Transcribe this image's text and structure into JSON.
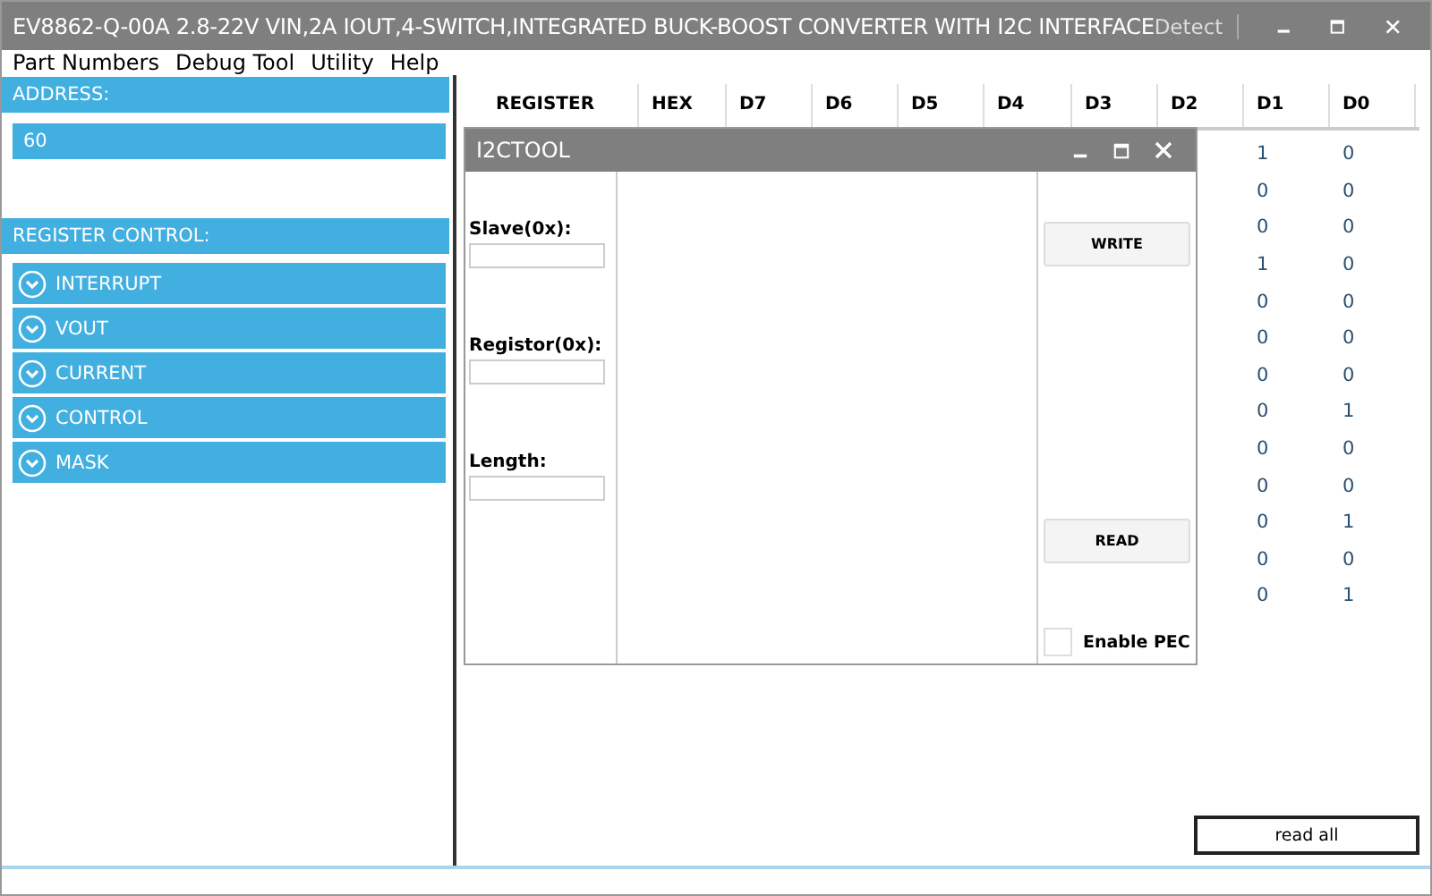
{
  "window": {
    "title": "EV8862-Q-00A 2.8-22V VIN,2A IOUT,4-SWITCH,INTEGRATED BUCK-BOOST CONVERTER WITH I2C INTERFACE",
    "detect": "Detect"
  },
  "menu": [
    "Part Numbers",
    "Debug Tool",
    "Utility",
    "Help"
  ],
  "sidebar": {
    "address_label": "ADDRESS:",
    "address_value": "60",
    "register_control_label": "REGISTER CONTROL:",
    "groups": [
      {
        "label": "INTERRUPT",
        "expanded": false
      },
      {
        "label": "VOUT",
        "expanded": false
      },
      {
        "label": "CURRENT",
        "expanded": false
      },
      {
        "label": "CONTROL",
        "expanded": false
      },
      {
        "label": "MASK",
        "expanded": false
      }
    ]
  },
  "table": {
    "columns": [
      "REGISTER",
      "HEX",
      "D7",
      "D6",
      "D5",
      "D4",
      "D3",
      "D2",
      "D1",
      "D0"
    ],
    "rows": [
      {
        "d1": "1",
        "d0": "0"
      },
      {
        "d1": "0",
        "d0": "0"
      },
      {
        "d1": "0",
        "d0": "0"
      },
      {
        "d1": "1",
        "d0": "0"
      },
      {
        "d1": "0",
        "d0": "0"
      },
      {
        "d1": "0",
        "d0": "0"
      },
      {
        "d1": "0",
        "d0": "0"
      },
      {
        "d1": "0",
        "d0": "1"
      },
      {
        "d1": "0",
        "d0": "0"
      },
      {
        "d1": "0",
        "d0": "0"
      },
      {
        "d1": "0",
        "d0": "1"
      },
      {
        "d1": "0",
        "d0": "0"
      },
      {
        "d1": "0",
        "d0": "1"
      }
    ]
  },
  "dialog": {
    "title": "I2CTOOL",
    "fields": [
      {
        "label": "Slave(0x):"
      },
      {
        "label": "Registor(0x):"
      },
      {
        "label": "Length:"
      }
    ],
    "write": "WRITE",
    "read": "READ",
    "pec": {
      "label": "Enable PEC",
      "checked": false
    }
  },
  "read_all": "read all"
}
